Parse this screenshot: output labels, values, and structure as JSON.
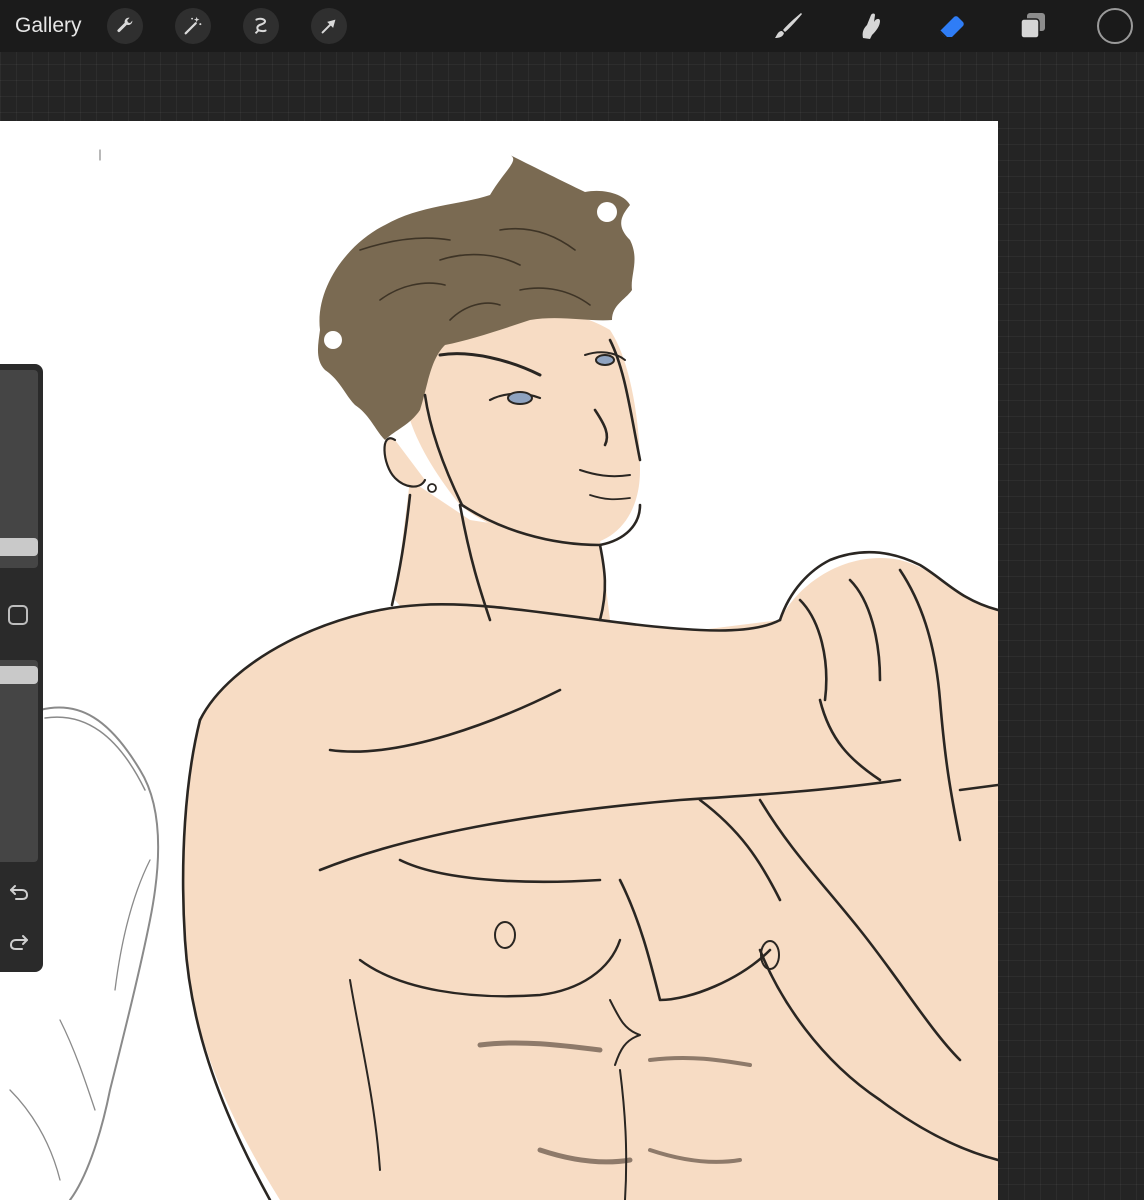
{
  "toolbar": {
    "gallery_label": "Gallery",
    "left_tools": [
      {
        "name": "wrench-icon"
      },
      {
        "name": "magic-wand-icon"
      },
      {
        "name": "selection-icon"
      },
      {
        "name": "transform-arrow-icon"
      }
    ],
    "right_tools": [
      {
        "name": "brush-icon"
      },
      {
        "name": "smudge-icon"
      },
      {
        "name": "eraser-icon",
        "active": true
      },
      {
        "name": "layers-icon"
      }
    ],
    "current_color": "#1a1a1a",
    "accent_color": "#2f7df6"
  },
  "sidebar": {
    "brush_size_level": 0.34,
    "opacity_level": 0.95,
    "icons": [
      "modify-square-icon",
      "undo-icon",
      "redo-icon"
    ]
  },
  "canvas": {
    "background": "#ffffff",
    "skin_color": "#f7dcc4",
    "hair_color": "#7a6a52",
    "line_color": "#2a2622"
  }
}
